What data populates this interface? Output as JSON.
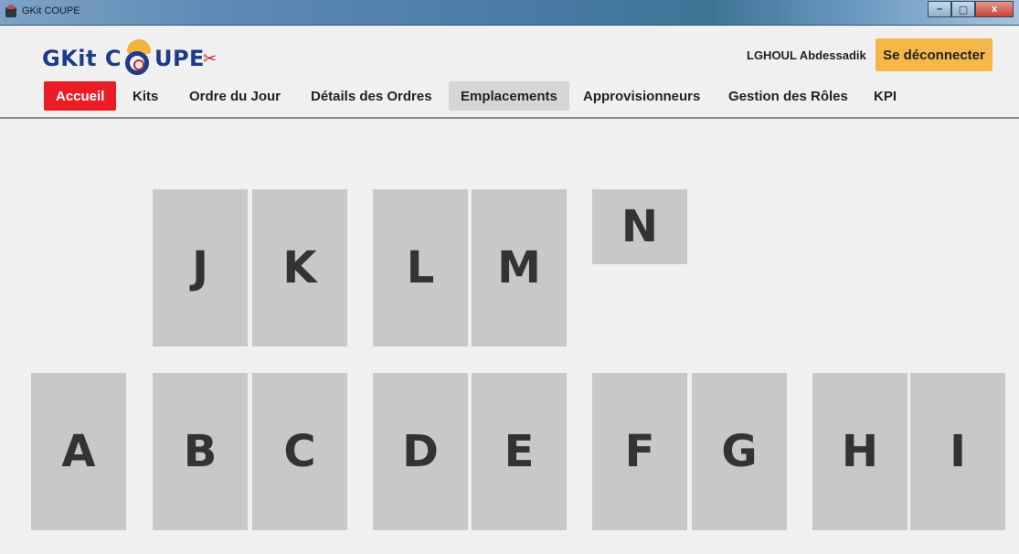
{
  "window": {
    "title": "GKit COUPE",
    "controls": {
      "minimize": "–",
      "maximize": "▢",
      "close": "x"
    }
  },
  "header": {
    "logo": {
      "left": "GKit C",
      "right": "UP",
      "last": "E",
      "scissors_icon": "✂"
    },
    "user_name": "LGHOUL Abdessadik",
    "logout_label": "Se déconnecter"
  },
  "nav": {
    "items": [
      {
        "label": "Accueil",
        "state": "active"
      },
      {
        "label": "Kits",
        "state": "normal"
      },
      {
        "label": "Ordre du Jour",
        "state": "normal"
      },
      {
        "label": "Détails des Ordres",
        "state": "normal"
      },
      {
        "label": "Emplacements",
        "state": "selected"
      },
      {
        "label": "Approvisionneurs",
        "state": "normal"
      },
      {
        "label": "Gestion des Rôles",
        "state": "normal"
      },
      {
        "label": "KPI",
        "state": "normal"
      }
    ]
  },
  "locations": {
    "top_row": [
      "J",
      "K",
      "L",
      "M",
      "N"
    ],
    "bottom_row": [
      "A",
      "B",
      "C",
      "D",
      "E",
      "F",
      "G",
      "H",
      "I"
    ]
  },
  "colors": {
    "accent_red": "#ec1c24",
    "logout_orange": "#f6b74a",
    "tile_gray": "#c8c8c8",
    "brand_blue": "#1e3a8a"
  }
}
